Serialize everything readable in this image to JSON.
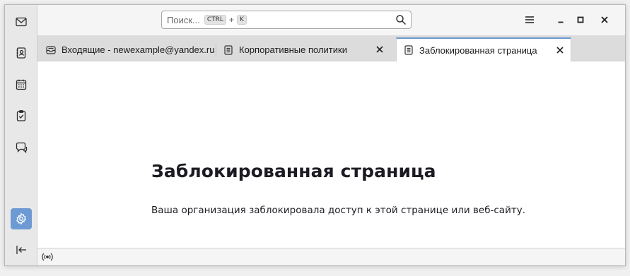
{
  "spaces": {
    "items": [
      {
        "icon": "mail-icon",
        "name": "mail"
      },
      {
        "icon": "address-book-icon",
        "name": "address-book"
      },
      {
        "icon": "calendar-icon",
        "name": "calendar"
      },
      {
        "icon": "tasks-icon",
        "name": "tasks"
      },
      {
        "icon": "chat-icon",
        "name": "chat"
      },
      {
        "icon": "settings-gear-icon",
        "name": "settings",
        "active": true
      },
      {
        "icon": "collapse-left-icon",
        "name": "collapse"
      }
    ],
    "active_color": "#6d9ad3"
  },
  "search": {
    "placeholder": "Поиск...",
    "shortcut_key1": "CTRL",
    "shortcut_plus": "+",
    "shortcut_key2": "K"
  },
  "tabs": [
    {
      "label": "Входящие - newexample@yandex.ru",
      "icon": "inbox-icon",
      "selected": false,
      "closable": false
    },
    {
      "label": "Корпоративные политики",
      "icon": "page-icon",
      "selected": false,
      "closable": true
    },
    {
      "label": "Заблокированная страница",
      "icon": "page-icon",
      "selected": true,
      "closable": true
    }
  ],
  "content": {
    "title": "Заблокированная страница",
    "description": "Ваша организация заблокировала доступ к этой странице или веб-сайту."
  },
  "colors": {
    "accent": "#6d9ad3",
    "text": "#1c1b22"
  }
}
